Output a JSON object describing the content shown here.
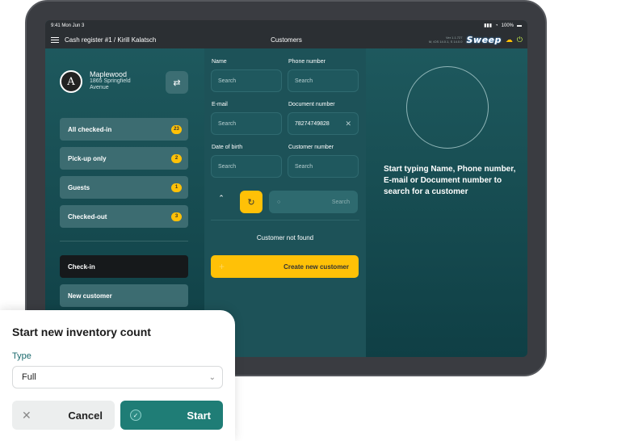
{
  "status_bar": {
    "time": "9:41 Mon Jun 3",
    "battery": "100%"
  },
  "top_bar": {
    "title": "Cash register #1 / Kirill Kalatsch",
    "screen": "Customers",
    "version_line1": "Ver 1.1.727",
    "version_line2": "M, iOS 14.0.1, S 14.0.0",
    "logo": "Sweep"
  },
  "venue": {
    "initial": "A",
    "name": "Maplewood",
    "address": "1865 Springfield Avenue"
  },
  "filters": [
    {
      "label": "All checked-in",
      "count": "23"
    },
    {
      "label": "Pick-up only",
      "count": "2"
    },
    {
      "label": "Guests",
      "count": "1"
    },
    {
      "label": "Checked-out",
      "count": "3"
    }
  ],
  "actions": {
    "checkin": "Check-in",
    "new_customer": "New customer"
  },
  "form": {
    "name": {
      "label": "Name",
      "placeholder": "Search"
    },
    "phone": {
      "label": "Phone number",
      "placeholder": "Search"
    },
    "email": {
      "label": "E-mail",
      "placeholder": "Search"
    },
    "document": {
      "label": "Document number",
      "value": "78274749828"
    },
    "dob": {
      "label": "Date of birth",
      "placeholder": "Search"
    },
    "customer_number": {
      "label": "Customer number",
      "placeholder": "Search"
    },
    "search_button": "Search",
    "not_found": "Customer not found",
    "create_button": "Create new customer"
  },
  "hint": "Start typing Name, Phone number, E-mail or Document number to search for a customer",
  "inventory": {
    "title": "Start new inventory count",
    "type_label": "Type",
    "type_value": "Full",
    "cancel": "Cancel",
    "start": "Start"
  },
  "colors": {
    "accent": "#ffc107",
    "teal": "#1f7d76",
    "panel": "#1d5258"
  }
}
